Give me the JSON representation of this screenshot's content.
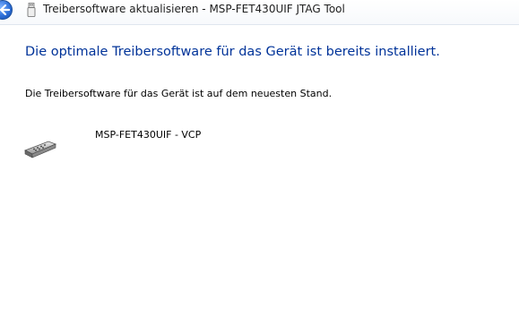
{
  "window": {
    "title": "Treibersoftware aktualisieren - MSP-FET430UIF JTAG Tool",
    "back_icon": "back-arrow-icon",
    "title_icon": "usb-device-icon"
  },
  "main": {
    "heading": "Die optimale Treibersoftware für das Gerät ist bereits installiert.",
    "description": "Die Treibersoftware für das Gerät ist auf dem neuesten Stand.",
    "device": {
      "name": "MSP-FET430UIF - VCP",
      "icon": "serial-port-icon"
    }
  },
  "colors": {
    "heading": "#003399",
    "accent": "#2d6fd8"
  }
}
